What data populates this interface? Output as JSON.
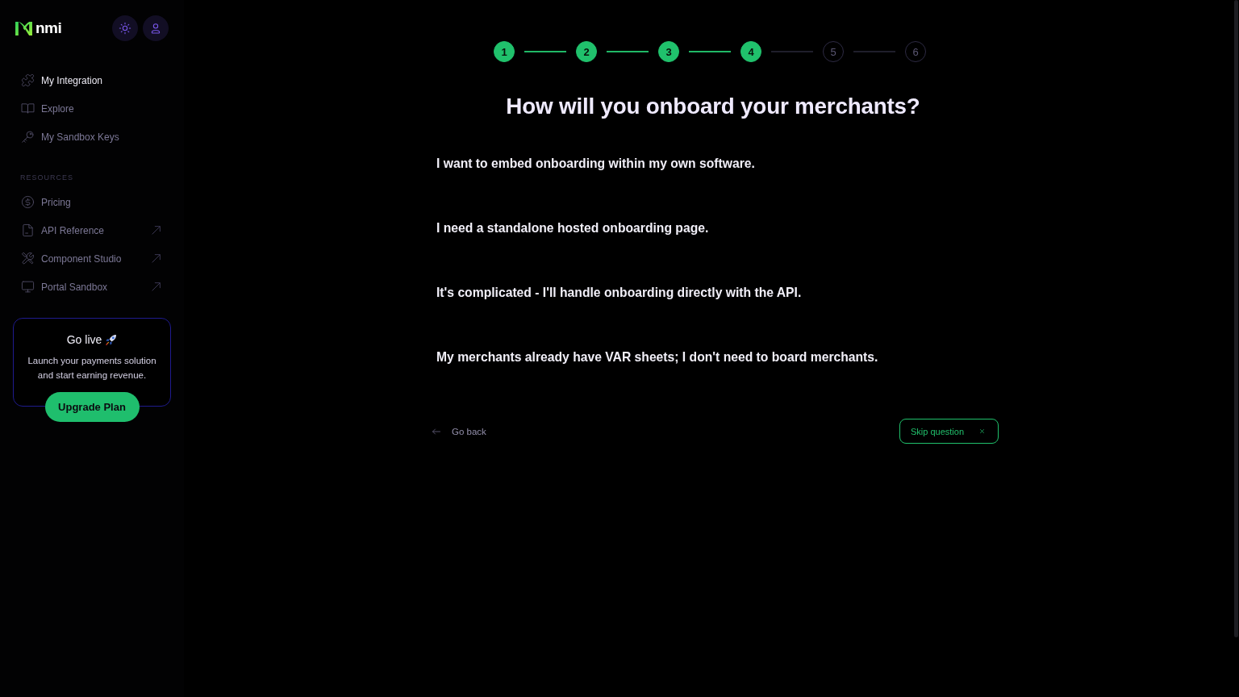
{
  "sidebar": {
    "logo": {
      "text": "nmi"
    },
    "nav": [
      {
        "label": "My Integration",
        "selected": true
      },
      {
        "label": "Explore",
        "selected": false
      },
      {
        "label": "My Sandbox Keys",
        "selected": false
      }
    ],
    "section_title": "RESOURCES",
    "resources": [
      {
        "label": "Pricing",
        "selected": false,
        "external": false
      },
      {
        "label": "API Reference",
        "selected": false,
        "external": true
      },
      {
        "label": "Component Studio",
        "selected": false,
        "external": true
      },
      {
        "label": "Portal Sandbox",
        "selected": false,
        "external": true
      }
    ],
    "promo": {
      "title": "Go live",
      "text": "Launch your payments solution and start earning revenue.",
      "button": "Upgrade Plan"
    }
  },
  "stepper": [
    {
      "label": "1",
      "completed": true
    },
    {
      "label": "2",
      "completed": true
    },
    {
      "label": "3",
      "completed": true
    },
    {
      "label": "4",
      "completed": true
    },
    {
      "label": "5",
      "completed": false
    },
    {
      "label": "6",
      "completed": false
    }
  ],
  "question": {
    "title": "How will you onboard your merchants?",
    "options": [
      "I want to embed onboarding within my own software.",
      "I need a standalone hosted onboarding page.",
      "It's complicated - I'll handle onboarding directly with the API.",
      "My merchants already have VAR sheets; I don't need to board merchants."
    ]
  },
  "footer": {
    "back": "Go back",
    "skip": "Skip question"
  }
}
